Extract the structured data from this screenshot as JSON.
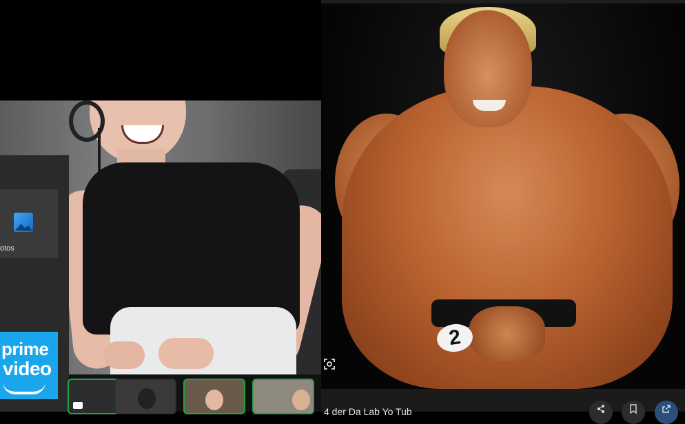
{
  "start_menu": {
    "photos_label": "otos",
    "prime_line1": "prime",
    "prime_line2": "video"
  },
  "lens": {
    "icon": "lens-search-icon"
  },
  "bodybuilder": {
    "badge_number": "2"
  },
  "bottom_bar": {
    "title": "4 der Da Lab Yo Tub",
    "share_icon": "share-icon",
    "save_icon": "bookmark-icon",
    "open_icon": "open-external-icon"
  },
  "colors": {
    "prime_blue": "#1aa6ec",
    "active_green": "#25a244",
    "photos_blue": "#3fa9f5"
  }
}
